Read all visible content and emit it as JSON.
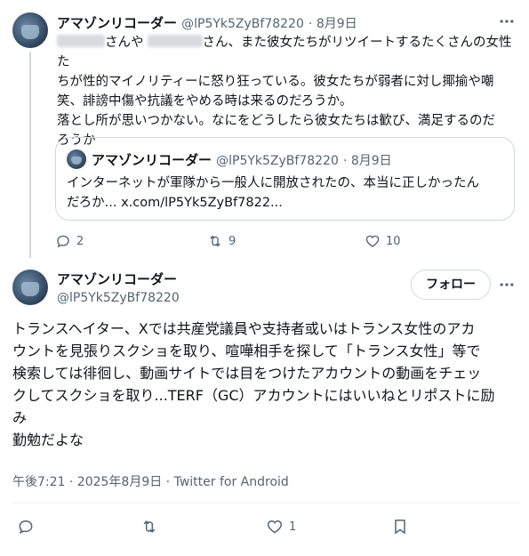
{
  "tweet1": {
    "author_name": "アマゾンリコーダー",
    "handle": "@lP5Yk5ZyBf78220",
    "date": "· 8月9日",
    "text_line1_a": "さんや",
    "text_line1_b": "さん、また彼女たちがリツイートするたくさんの女性た",
    "text_line2": "ちが性的マイノリティーに怒り狂っている。彼女たちが弱者に対し揶揄や嘲",
    "text_line3": "笑、誹謗中傷や抗議をやめる時は来るのだろうか。",
    "text_line4": "落とし所が思いつかない。なにをどうしたら彼女たちは歓び、満足するのだ",
    "text_line5": "ろうか",
    "replies": "2",
    "retweets": "9",
    "likes": "10"
  },
  "quote": {
    "author_name": "アマゾンリコーダー",
    "handle": "@lP5Yk5ZyBf78220",
    "date": "· 8月9日",
    "text_line1": "インターネットが軍隊から一般人に開放されたの、本当に正しかったん",
    "text_line2": "だろか... x.com/lP5Yk5ZyBf7822..."
  },
  "tweet2": {
    "author_name": "アマゾンリコーダー",
    "handle": "@lP5Yk5ZyBf78220",
    "follow_label": "フォロー",
    "text_line1": "トランスヘイター、Xでは共産党議員や支持者或いはトランス女性のアカ",
    "text_line2": "ウントを見張りスクショを取り、喧嘩相手を探して「トランス女性」等で",
    "text_line3": "検索しては徘徊し、動画サイトでは目をつけたアカウントの動画をチェッ",
    "text_line4": "クしてスクショを取り...TERF（GC）アカウントにはいいねとリポストに励",
    "text_line5": "み",
    "text_line6": "勤勉だよな",
    "timestamp": "午後7:21 · 2025年8月9日 · Twitter for Android",
    "likes": "1"
  },
  "icons": {
    "reply": "reply-icon",
    "retweet": "retweet-icon",
    "like": "heart-icon",
    "bookmark": "bookmark-icon",
    "more": "more-icon"
  }
}
